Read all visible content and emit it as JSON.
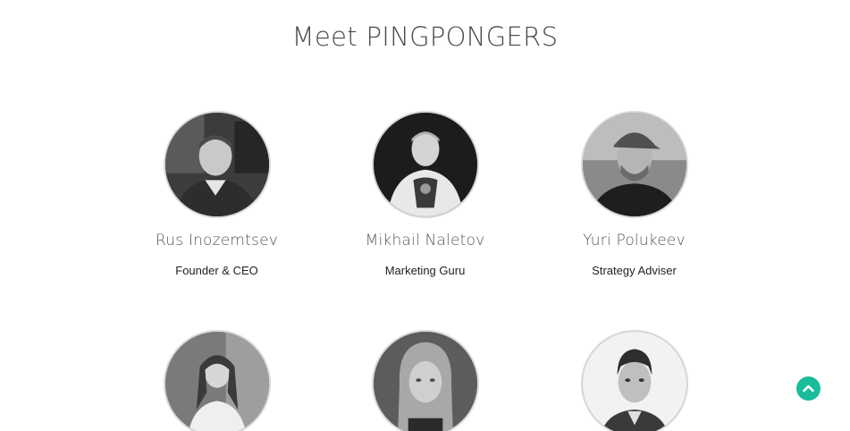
{
  "section": {
    "title": "Meet PINGPONGERS"
  },
  "team": [
    {
      "name": "Rus Inozemtsev",
      "role": "Founder & CEO"
    },
    {
      "name": "Mikhail Naletov",
      "role": "Marketing Guru"
    },
    {
      "name": "Yuri Polukeev",
      "role": "Strategy Adviser"
    },
    {
      "name": "",
      "role": ""
    },
    {
      "name": "",
      "role": ""
    },
    {
      "name": "",
      "role": ""
    }
  ],
  "scroll_top": {
    "icon": "chevron-up-icon",
    "color": "#1abc9c"
  }
}
